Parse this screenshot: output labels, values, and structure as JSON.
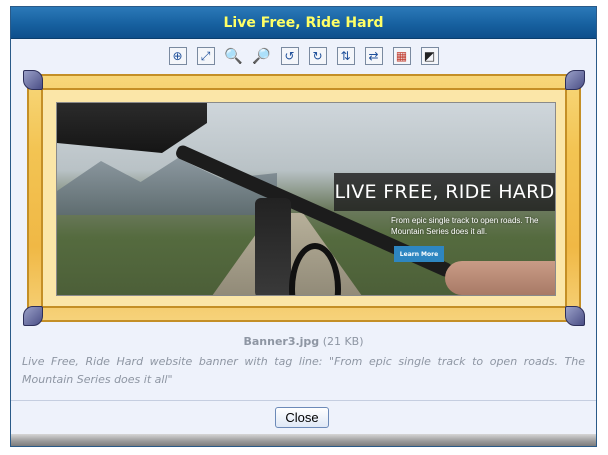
{
  "window": {
    "title": "Live Free, Ride Hard"
  },
  "toolbar": {
    "buttons": [
      {
        "name": "zoom-fit-icon",
        "glyph": "⊕"
      },
      {
        "name": "fit-window-icon",
        "glyph": "⤢"
      },
      {
        "name": "zoom-in-icon",
        "glyph": "🔍"
      },
      {
        "name": "zoom-out-icon",
        "glyph": "🔎"
      },
      {
        "name": "rotate-left-icon",
        "glyph": "↺"
      },
      {
        "name": "rotate-right-icon",
        "glyph": "↻"
      },
      {
        "name": "flip-vertical-icon",
        "glyph": "⇅"
      },
      {
        "name": "flip-horizontal-icon",
        "glyph": "⇄"
      },
      {
        "name": "grid-icon",
        "glyph": "▦"
      },
      {
        "name": "color-adjust-icon",
        "glyph": "◩"
      }
    ]
  },
  "image": {
    "banner_heading": "LIVE FREE, RIDE HARD",
    "banner_subtext": "From epic single track to open roads. The Mountain Series does it all.",
    "banner_button": "Learn More"
  },
  "file": {
    "name": "Banner3.jpg",
    "size": "(21 KB)"
  },
  "description": "Live Free, Ride Hard website banner with tag line: \"From epic single track to open roads. The Mountain Series does it all\"",
  "footer": {
    "close_label": "Close"
  }
}
